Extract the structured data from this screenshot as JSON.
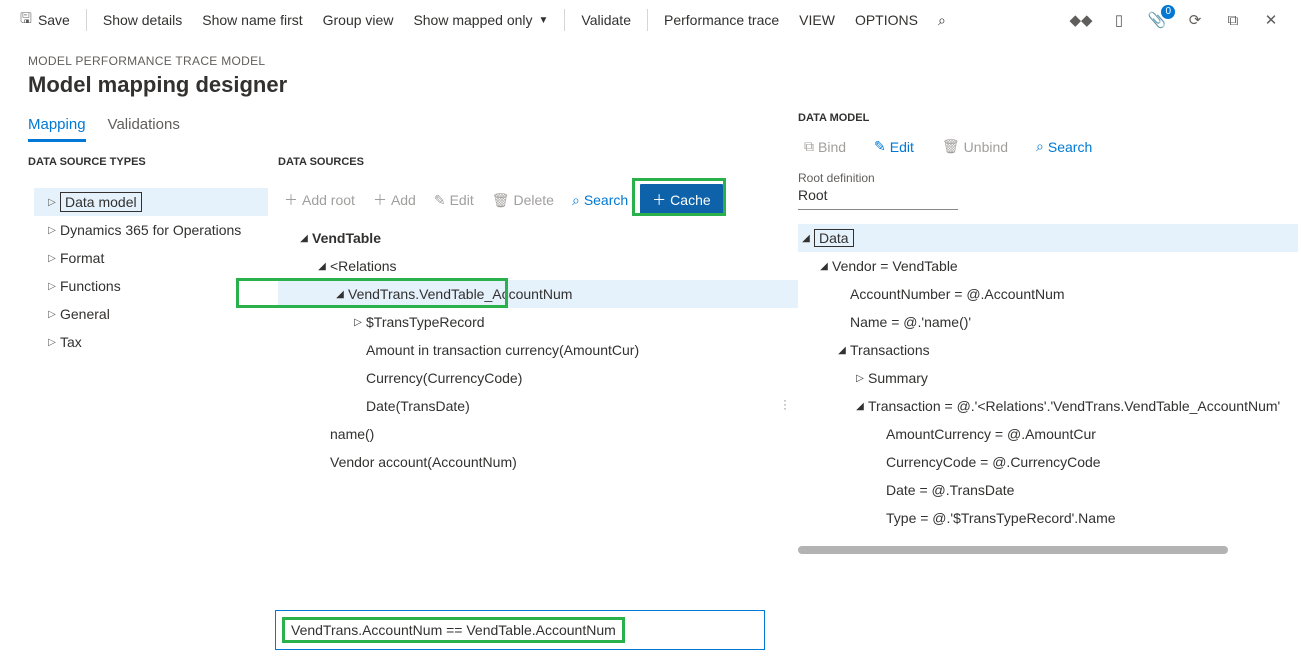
{
  "toolbar": {
    "save": "Save",
    "show_details": "Show details",
    "show_name_first": "Show name first",
    "group_view": "Group view",
    "show_mapped_only": "Show mapped only",
    "validate": "Validate",
    "performance_trace": "Performance trace",
    "view": "VIEW",
    "options": "OPTIONS",
    "notif_count": "0"
  },
  "page": {
    "breadcrumb": "MODEL PERFORMANCE TRACE MODEL",
    "title": "Model mapping designer"
  },
  "tabs": {
    "mapping": "Mapping",
    "validations": "Validations"
  },
  "left": {
    "heading": "DATA SOURCE TYPES",
    "items": [
      "Data model",
      "Dynamics 365 for Operations",
      "Format",
      "Functions",
      "General",
      "Tax"
    ]
  },
  "ds": {
    "heading": "DATA SOURCES",
    "btn_add_root": "Add root",
    "btn_add": "Add",
    "btn_edit": "Edit",
    "btn_delete": "Delete",
    "btn_search": "Search",
    "btn_cache": "Cache",
    "tree": {
      "vendtable": "VendTable",
      "relations": "<Relations",
      "vt_account": "VendTrans.VendTable_AccountNum",
      "transtype": "$TransTypeRecord",
      "amount": "Amount in transaction currency(AmountCur)",
      "currency": "Currency(CurrencyCode)",
      "date": "Date(TransDate)",
      "name": "name()",
      "vendor_account": "Vendor account(AccountNum)"
    }
  },
  "expr": "VendTrans.AccountNum == VendTable.AccountNum",
  "dm": {
    "heading": "DATA MODEL",
    "btn_bind": "Bind",
    "btn_edit": "Edit",
    "btn_unbind": "Unbind",
    "btn_search": "Search",
    "root_label": "Root definition",
    "root_value": "Root",
    "tree": {
      "data": "Data",
      "vendor": "Vendor = VendTable",
      "accountnumber": "AccountNumber = @.AccountNum",
      "name": "Name = @.'name()'",
      "transactions": "Transactions",
      "summary": "Summary",
      "transaction": "Transaction = @.'<Relations'.'VendTrans.VendTable_AccountNum'",
      "amountcurrency": "AmountCurrency = @.AmountCur",
      "currencycode": "CurrencyCode = @.CurrencyCode",
      "date": "Date = @.TransDate",
      "type": "Type = @.'$TransTypeRecord'.Name"
    }
  }
}
